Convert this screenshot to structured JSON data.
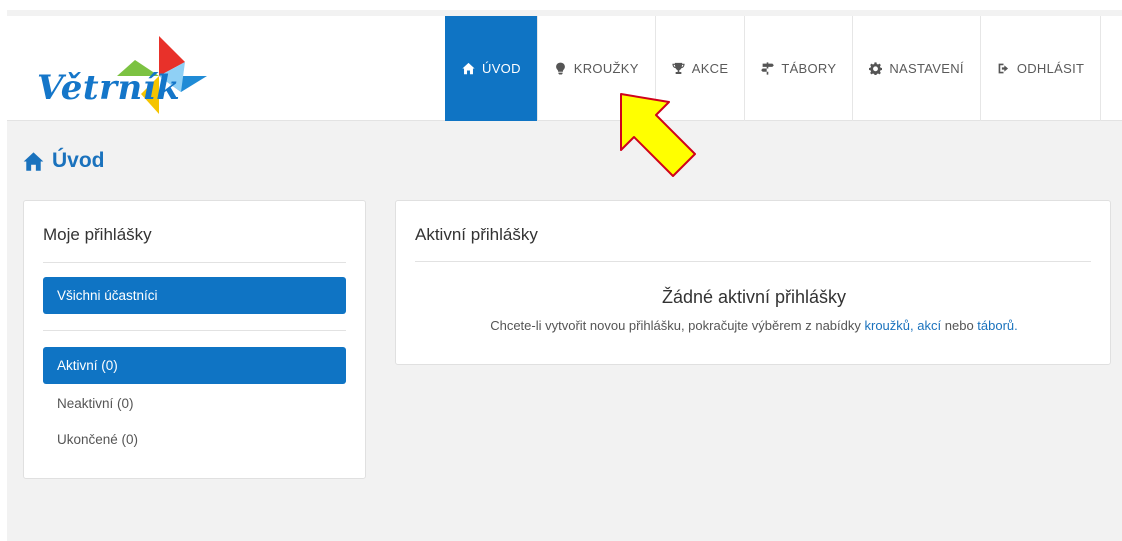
{
  "brand": {
    "logo_text": "Větrník"
  },
  "nav": [
    {
      "label": "ÚVOD",
      "icon": "home-icon",
      "active": true
    },
    {
      "label": "KROUŽKY",
      "icon": "lightbulb-icon",
      "active": false
    },
    {
      "label": "AKCE",
      "icon": "trophy-icon",
      "active": false
    },
    {
      "label": "TÁBORY",
      "icon": "signpost-icon",
      "active": false
    },
    {
      "label": "NASTAVENÍ",
      "icon": "gear-icon",
      "active": false
    },
    {
      "label": "ODHLÁSIT",
      "icon": "logout-icon",
      "active": false
    }
  ],
  "page": {
    "title": "Úvod"
  },
  "sidebar": {
    "title": "Moje přihlášky",
    "participants_label": "Všichni účastníci",
    "filters": [
      {
        "label": "Aktivní (0)",
        "active": true
      },
      {
        "label": "Neaktivní (0)",
        "active": false
      },
      {
        "label": "Ukončené (0)",
        "active": false
      }
    ]
  },
  "main": {
    "title": "Aktivní přihlášky",
    "empty_title": "Žádné aktivní přihlášky",
    "empty_prefix": "Chcete-li vytvořit novou přihlášku, pokračujte výběrem z nabídky",
    "link_clubs": "kroužků",
    "sep1": ",",
    "link_events": "akcí",
    "word_or": "nebo",
    "link_camps": "táborů",
    "end": "."
  },
  "colors": {
    "accent": "#0f74c4",
    "link": "#1a72bd",
    "annotation_arrow": "#ffff00",
    "annotation_arrow_border": "#d0021b"
  }
}
